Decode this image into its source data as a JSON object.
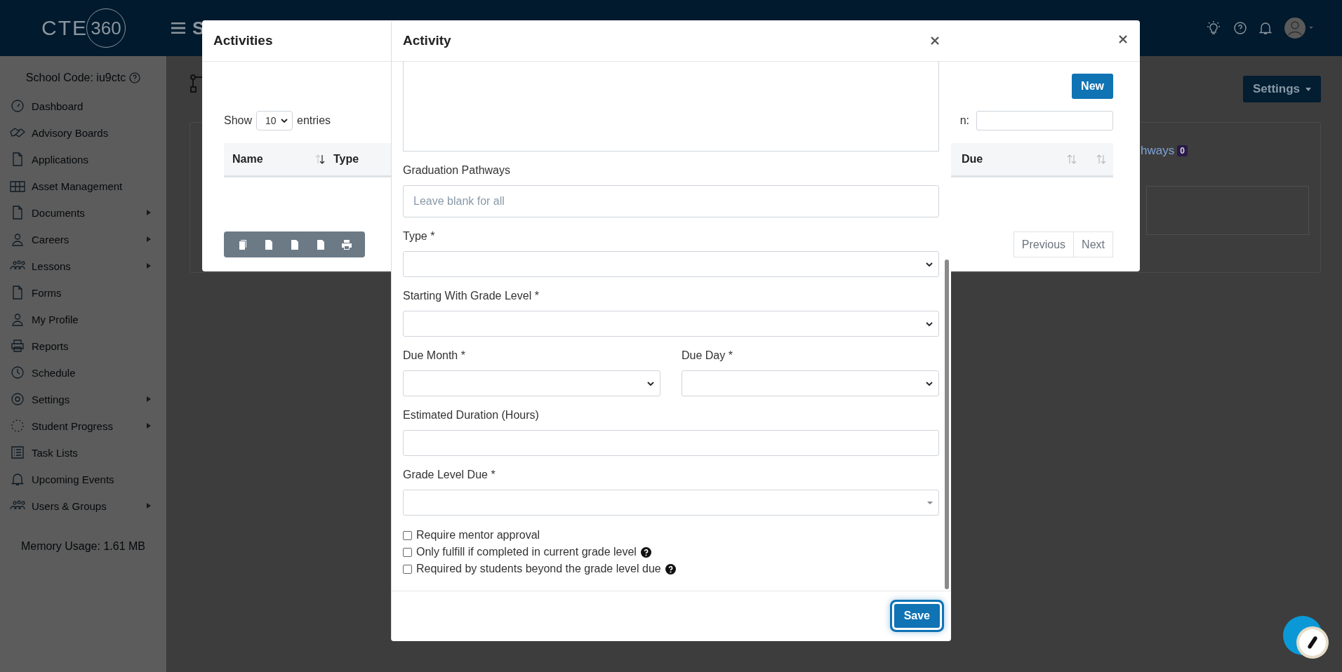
{
  "header": {
    "logo": [
      "CTE",
      "360"
    ],
    "title": "S"
  },
  "sidebar": {
    "school_code": "School Code: iu9ctc",
    "items": [
      {
        "label": "Dashboard",
        "has_submenu": false
      },
      {
        "label": "Advisory Boards",
        "has_submenu": false
      },
      {
        "label": "Applications",
        "has_submenu": false
      },
      {
        "label": "Asset Management",
        "has_submenu": false
      },
      {
        "label": "Documents",
        "has_submenu": true
      },
      {
        "label": "Careers",
        "has_submenu": true
      },
      {
        "label": "Lessons",
        "has_submenu": true
      },
      {
        "label": "Forms",
        "has_submenu": false
      },
      {
        "label": "My Profile",
        "has_submenu": false
      },
      {
        "label": "Reports",
        "has_submenu": false
      },
      {
        "label": "Schedule",
        "has_submenu": false
      },
      {
        "label": "Settings",
        "has_submenu": true
      },
      {
        "label": "Student Progress",
        "has_submenu": true
      },
      {
        "label": "Task Lists",
        "has_submenu": false
      },
      {
        "label": "Upcoming Events",
        "has_submenu": false
      },
      {
        "label": "Users & Groups",
        "has_submenu": true
      }
    ],
    "memory": "Memory Usage: 1.61 MB"
  },
  "page": {
    "settings_button": "Settings",
    "card_text": "hways",
    "badge": "0"
  },
  "activities_modal": {
    "title": "Activities",
    "new_button": "New",
    "show": "Show",
    "entries_select": "10",
    "entries": "entries",
    "search_label": "n:",
    "columns": [
      "Name",
      "Type",
      "Due"
    ],
    "pagination": [
      "Previous",
      "Next"
    ]
  },
  "activity_modal": {
    "title": "Activity",
    "rows": [
      {
        "fields": [
          {
            "kind": "text",
            "label": "Graduation Pathways",
            "placeholder": "Leave blank for all"
          }
        ]
      },
      {
        "fields": [
          {
            "kind": "select",
            "label": "Type *"
          }
        ]
      },
      {
        "fields": [
          {
            "kind": "select",
            "label": "Starting With Grade Level *"
          }
        ]
      },
      {
        "fields": [
          {
            "kind": "select",
            "label": "Due Month *"
          },
          {
            "kind": "select",
            "label": "Due Day *"
          }
        ]
      },
      {
        "fields": [
          {
            "kind": "number",
            "label": "Estimated Duration (Hours)"
          }
        ]
      },
      {
        "fields": [
          {
            "kind": "combo",
            "label": "Grade Level Due *"
          }
        ]
      }
    ],
    "checkboxes": [
      {
        "label": "Require mentor approval",
        "checked": false,
        "help": false
      },
      {
        "label": "Only fulfill if completed in current grade level",
        "checked": false,
        "help": true
      },
      {
        "label": "Required by students beyond the grade level due",
        "checked": false,
        "help": true
      }
    ],
    "save_button": "Save"
  }
}
